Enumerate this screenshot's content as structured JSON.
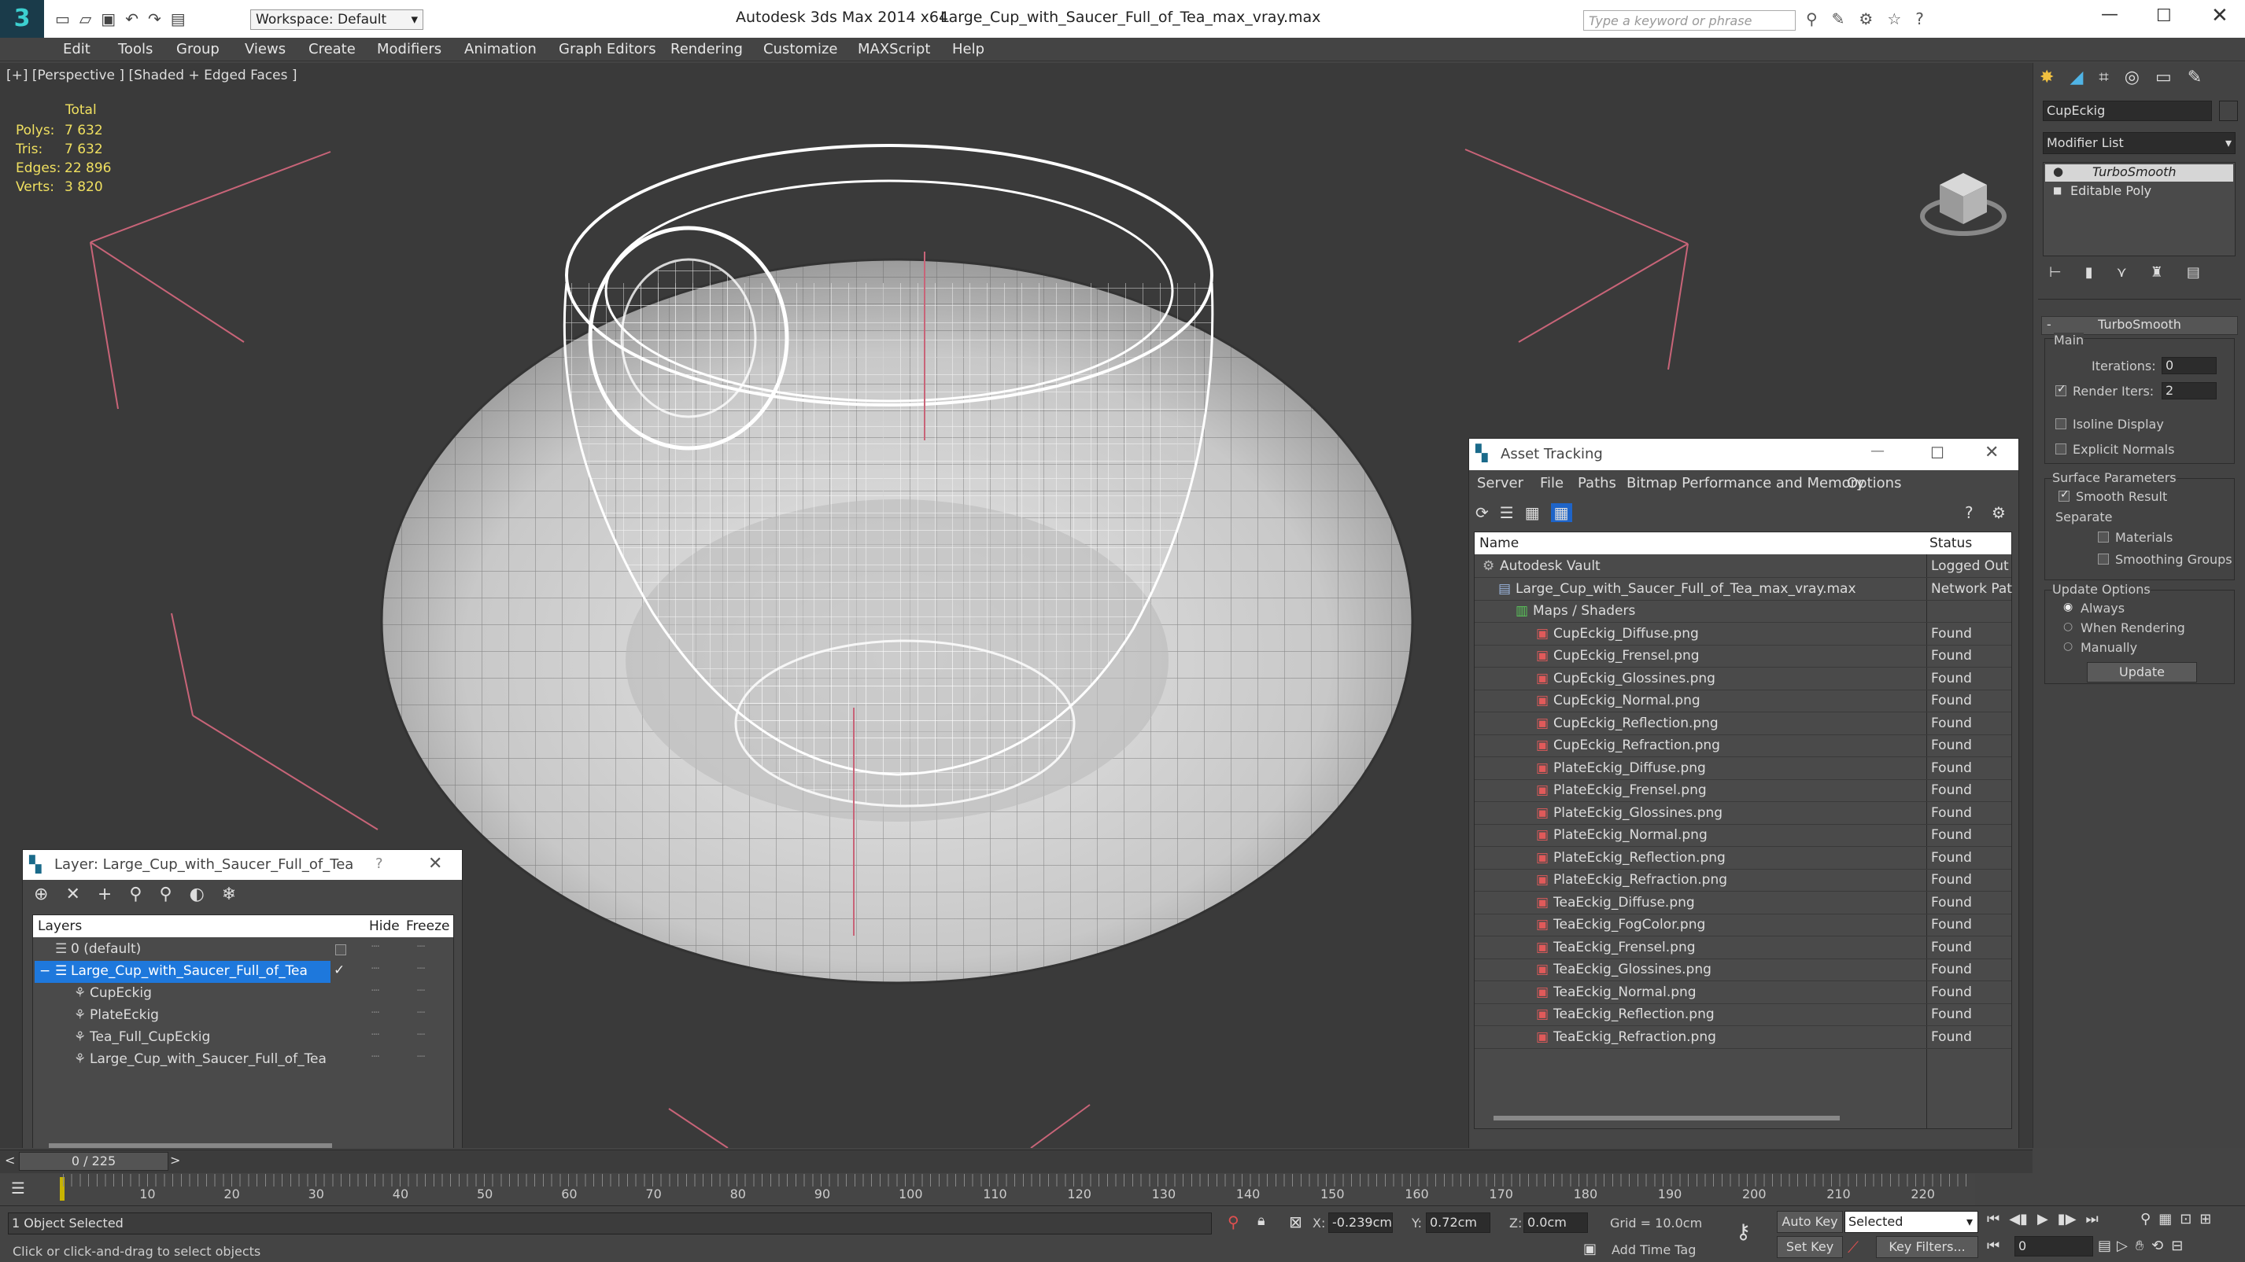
{
  "titlebar": {
    "workspace": "Workspace: Default",
    "app": "Autodesk 3ds Max  2014 x64",
    "file": "Large_Cup_with_Saucer_Full_of_Tea_max_vray.max",
    "search_placeholder": "Type a keyword or phrase"
  },
  "menu": [
    "Edit",
    "Tools",
    "Group",
    "Views",
    "Create",
    "Modifiers",
    "Animation",
    "Graph Editors",
    "Rendering",
    "Customize",
    "MAXScript",
    "Help"
  ],
  "viewport": {
    "label": "[+] [Perspective ] [Shaded + Edged Faces ]",
    "stats_header": "Total",
    "stats": [
      {
        "k": "Polys:",
        "v": "7 632"
      },
      {
        "k": "Tris:",
        "v": "7 632"
      },
      {
        "k": "Edges:",
        "v": "22 896"
      },
      {
        "k": "Verts:",
        "v": "3 820"
      }
    ]
  },
  "command_panel": {
    "object_name": "CupEckig",
    "modifier_list": "Modifier List",
    "stack": [
      "TurboSmooth",
      "Editable Poly"
    ],
    "rollout_title": "TurboSmooth",
    "main_group": "Main",
    "iterations_label": "Iterations:",
    "iterations_value": "0",
    "render_iters_label": "Render Iters:",
    "render_iters_value": "2",
    "isoline": "Isoline Display",
    "explicit": "Explicit Normals",
    "surface_group": "Surface Parameters",
    "smooth_result": "Smooth Result",
    "separate": "Separate",
    "materials": "Materials",
    "smoothing_groups": "Smoothing Groups",
    "update_group": "Update Options",
    "always": "Always",
    "when_rendering": "When Rendering",
    "manually": "Manually",
    "update_button": "Update"
  },
  "asset_tracking": {
    "title": "Asset Tracking",
    "menu": [
      "Server",
      "File",
      "Paths",
      "Bitmap Performance and Memory",
      "Options"
    ],
    "col_name": "Name",
    "col_status": "Status",
    "rows": [
      {
        "name": "Autodesk Vault",
        "status": "Logged Out",
        "indent": 0,
        "type": "vault"
      },
      {
        "name": "Large_Cup_with_Saucer_Full_of_Tea_max_vray.max",
        "status": "Network Pat",
        "indent": 1,
        "type": "max"
      },
      {
        "name": "Maps / Shaders",
        "status": "",
        "indent": 2,
        "type": "folder"
      },
      {
        "name": "CupEckig_Diffuse.png",
        "status": "Found",
        "indent": 3,
        "type": "png"
      },
      {
        "name": "CupEckig_Frensel.png",
        "status": "Found",
        "indent": 3,
        "type": "png"
      },
      {
        "name": "CupEckig_Glossines.png",
        "status": "Found",
        "indent": 3,
        "type": "png"
      },
      {
        "name": "CupEckig_Normal.png",
        "status": "Found",
        "indent": 3,
        "type": "png"
      },
      {
        "name": "CupEckig_Reflection.png",
        "status": "Found",
        "indent": 3,
        "type": "png"
      },
      {
        "name": "CupEckig_Refraction.png",
        "status": "Found",
        "indent": 3,
        "type": "png"
      },
      {
        "name": "PlateEckig_Diffuse.png",
        "status": "Found",
        "indent": 3,
        "type": "png"
      },
      {
        "name": "PlateEckig_Frensel.png",
        "status": "Found",
        "indent": 3,
        "type": "png"
      },
      {
        "name": "PlateEckig_Glossines.png",
        "status": "Found",
        "indent": 3,
        "type": "png"
      },
      {
        "name": "PlateEckig_Normal.png",
        "status": "Found",
        "indent": 3,
        "type": "png"
      },
      {
        "name": "PlateEckig_Reflection.png",
        "status": "Found",
        "indent": 3,
        "type": "png"
      },
      {
        "name": "PlateEckig_Refraction.png",
        "status": "Found",
        "indent": 3,
        "type": "png"
      },
      {
        "name": "TeaEckig_Diffuse.png",
        "status": "Found",
        "indent": 3,
        "type": "png"
      },
      {
        "name": "TeaEckig_FogColor.png",
        "status": "Found",
        "indent": 3,
        "type": "png"
      },
      {
        "name": "TeaEckig_Frensel.png",
        "status": "Found",
        "indent": 3,
        "type": "png"
      },
      {
        "name": "TeaEckig_Glossines.png",
        "status": "Found",
        "indent": 3,
        "type": "png"
      },
      {
        "name": "TeaEckig_Normal.png",
        "status": "Found",
        "indent": 3,
        "type": "png"
      },
      {
        "name": "TeaEckig_Reflection.png",
        "status": "Found",
        "indent": 3,
        "type": "png"
      },
      {
        "name": "TeaEckig_Refraction.png",
        "status": "Found",
        "indent": 3,
        "type": "png"
      }
    ]
  },
  "layer_window": {
    "title": "Layer: Large_Cup_with_Saucer_Full_of_Tea",
    "help": "?",
    "col_layers": "Layers",
    "col_hide": "Hide",
    "col_freeze": "Freeze",
    "rows": [
      {
        "name": "0 (default)",
        "indent": 0,
        "selected": false
      },
      {
        "name": "Large_Cup_with_Saucer_Full_of_Tea",
        "indent": 0,
        "selected": true
      },
      {
        "name": "CupEckig",
        "indent": 1,
        "selected": false
      },
      {
        "name": "PlateEckig",
        "indent": 1,
        "selected": false
      },
      {
        "name": "Tea_Full_CupEckig",
        "indent": 1,
        "selected": false
      },
      {
        "name": "Large_Cup_with_Saucer_Full_of_Tea",
        "indent": 1,
        "selected": false
      }
    ]
  },
  "timeline": {
    "frame": "0 / 225",
    "ticks": [
      "10",
      "20",
      "30",
      "40",
      "50",
      "60",
      "70",
      "80",
      "90",
      "100",
      "110",
      "120",
      "130",
      "140",
      "150",
      "160",
      "170",
      "180",
      "190",
      "200",
      "210",
      "220"
    ]
  },
  "status": {
    "selected": "1 Object Selected",
    "prompt": "Click or click-and-drag to select objects",
    "x_label": "X:",
    "x": "-0.239cm",
    "y_label": "Y:",
    "y": "0.72cm",
    "z_label": "Z:",
    "z": "0.0cm",
    "grid": "Grid = 10.0cm",
    "auto_key": "Auto Key",
    "selected_dropdown": "Selected",
    "set_key": "Set Key",
    "key_filters": "Key Filters...",
    "add_time_tag": "Add Time Tag",
    "frame_field": "0"
  },
  "colors": {
    "accent": "#1e64c8",
    "found": "#dddddd",
    "selection": "#1e78dc"
  }
}
